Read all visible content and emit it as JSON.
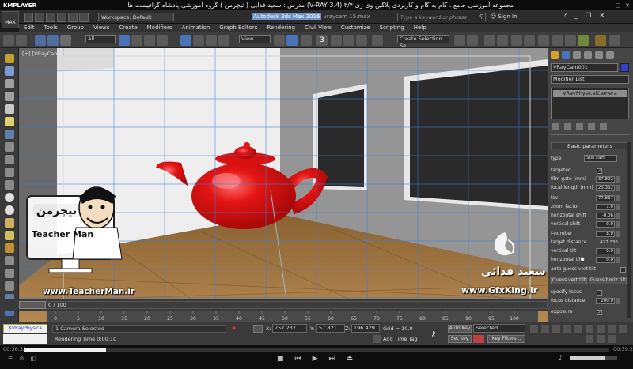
{
  "player": {
    "logo": "KMPLAYER",
    "title": "مجموعه آموزشی جامع ، گام به گام و کاربردی پلاگین وی ری ۳/۴ (V-RAY 3.4) مدرس : سعید فدایی ( تیچرمن ) گروه آموزشی پادشاه گرافیست ها",
    "time_current": "00:36:32",
    "time_total": "00:39:28",
    "progress_fraction": 0.14
  },
  "app": {
    "logo_label": "MAX",
    "workspace": "Workspace: Default",
    "title_prefix": "Autodesk 3ds Max 2016",
    "title_file": "vraycam 15.max",
    "search_placeholder": "Type a keyword or phrase",
    "sign_in": "Sign In"
  },
  "menu": [
    "Edit",
    "Tools",
    "Group",
    "Views",
    "Create",
    "Modifiers",
    "Animation",
    "Graph Editors",
    "Rendering",
    "Civil View",
    "Customize",
    "Scripting",
    "Help"
  ],
  "toolbar": {
    "filter": "All",
    "ref_coord": "View",
    "snap_label": "3",
    "selection_set": "Create Selection Se"
  },
  "viewport": {
    "label": "[+] [VRayCam001 ] [Shaded ]",
    "teapot_color": "#e31414"
  },
  "command_panel": {
    "object_name": "VRayCam001",
    "modifier_list": "Modifier List",
    "stack_item": "VRayPhysicalCamera",
    "rollout": "Basic parameters",
    "type_label": "type",
    "type_value": "Still cam",
    "params": [
      {
        "label": "targeted",
        "check": "✓"
      },
      {
        "label": "film gate (mm)",
        "value": "37.822"
      },
      {
        "label": "focal length (mm)",
        "value": "23.362"
      },
      {
        "label": "fov",
        "value": "77.837"
      },
      {
        "label": "zoom factor",
        "value": "1.0"
      },
      {
        "label": "horizontal shift",
        "value": "-0.06"
      },
      {
        "label": "vertical shift",
        "value": "0.0"
      },
      {
        "label": "f-number",
        "value": "8.0"
      },
      {
        "label": "target distance",
        "value": "427.336"
      },
      {
        "label": "vertical tilt",
        "value": "0.0"
      },
      {
        "label": "horizontal tilt",
        "value": "0.0"
      },
      {
        "label": "auto guess vert tilt",
        "check": ""
      }
    ],
    "btn_guess_vert": "Guess vert tilt",
    "btn_guess_horiz": "Guess horiz tilt",
    "specify_focus": "specify focus",
    "focus_distance_label": "focus distance",
    "focus_distance": "200.0",
    "exposure": "exposure",
    "exposure_check": "✓"
  },
  "timeline": {
    "slider": "0 / 100",
    "ticks": [
      "0",
      "5",
      "10",
      "15",
      "20",
      "25",
      "30",
      "35",
      "40",
      "45",
      "50",
      "55",
      "60",
      "65",
      "70",
      "75",
      "80",
      "85",
      "90",
      "95",
      "100"
    ]
  },
  "status": {
    "vray_badge": "$VRayPhysica",
    "selected": "1 Camera Selected",
    "render_time": "Rendering Time 0:00:10",
    "x_label": "X:",
    "x": "757.237",
    "y_label": "Y:",
    "y": "57.821",
    "z_label": "Z:",
    "z": "196.429",
    "grid": "Grid = 10.0",
    "add_time_tag": "Add Time Tag",
    "auto_key": "Auto Key",
    "set_key": "Set Key",
    "selected_dd": "Selected",
    "key_filters": "Key Filters..."
  },
  "overlays": {
    "teacher_brand": "Teacher Man",
    "teacher_fa": "تیچرمن",
    "teacher_url": "www.TeacherMan.ir",
    "gfx_url": "www.GfxKing.ir",
    "farsi_name": "سعید فدائی"
  }
}
